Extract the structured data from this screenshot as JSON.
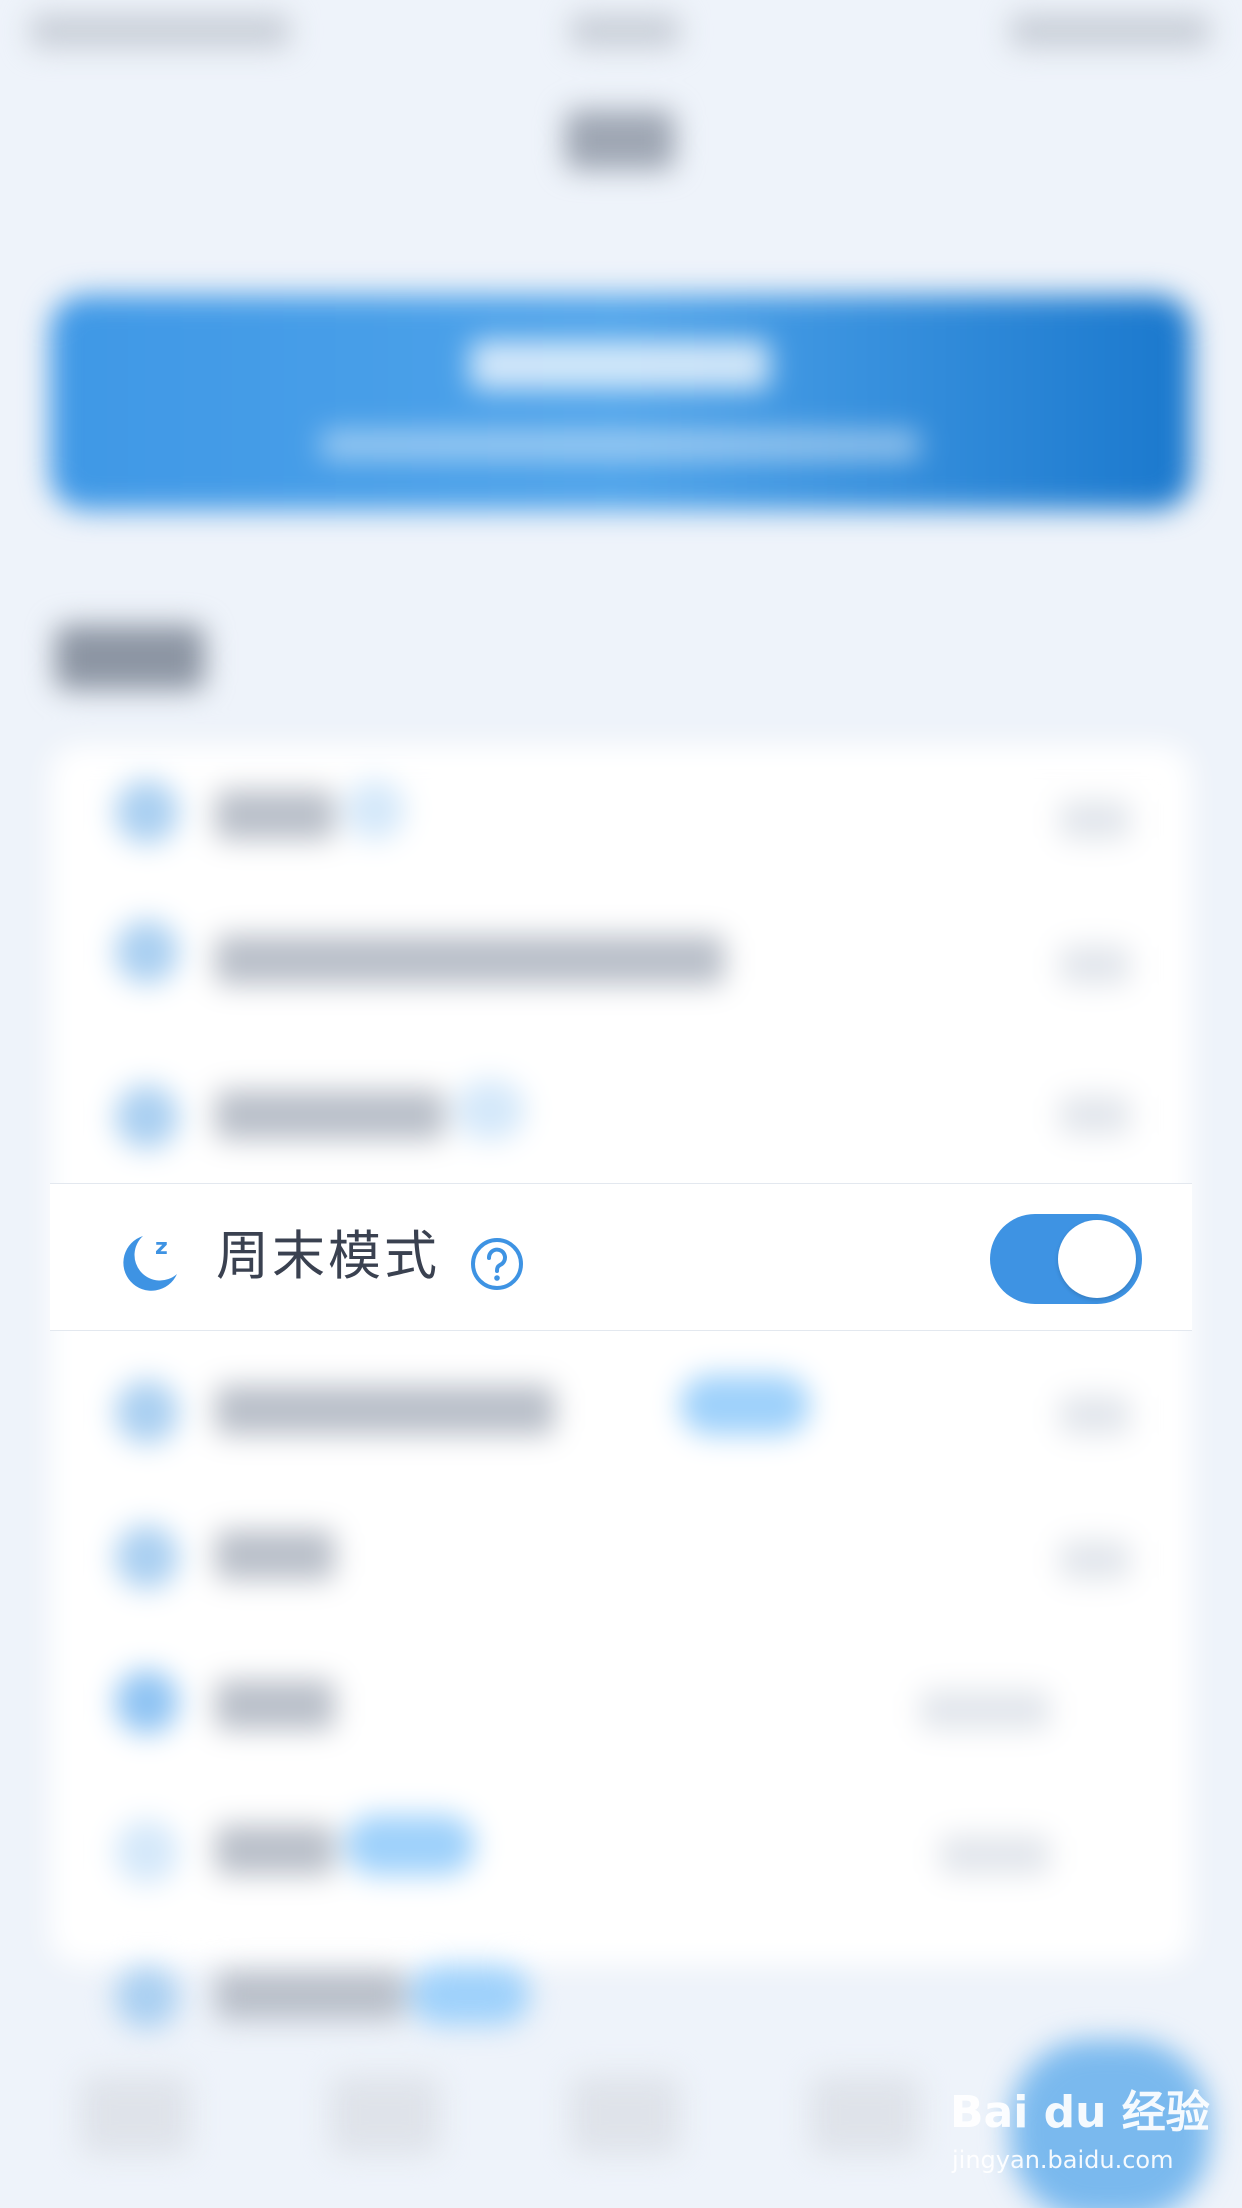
{
  "setting_row": {
    "label": "周末模式",
    "icon": "moon-sleep-icon",
    "help_icon": "question-circle-icon",
    "toggle_on": true,
    "accent_color": "#3e93e3"
  },
  "watermark": {
    "brand": "Bai du 经验",
    "url": "jingyan.baidu.com"
  }
}
